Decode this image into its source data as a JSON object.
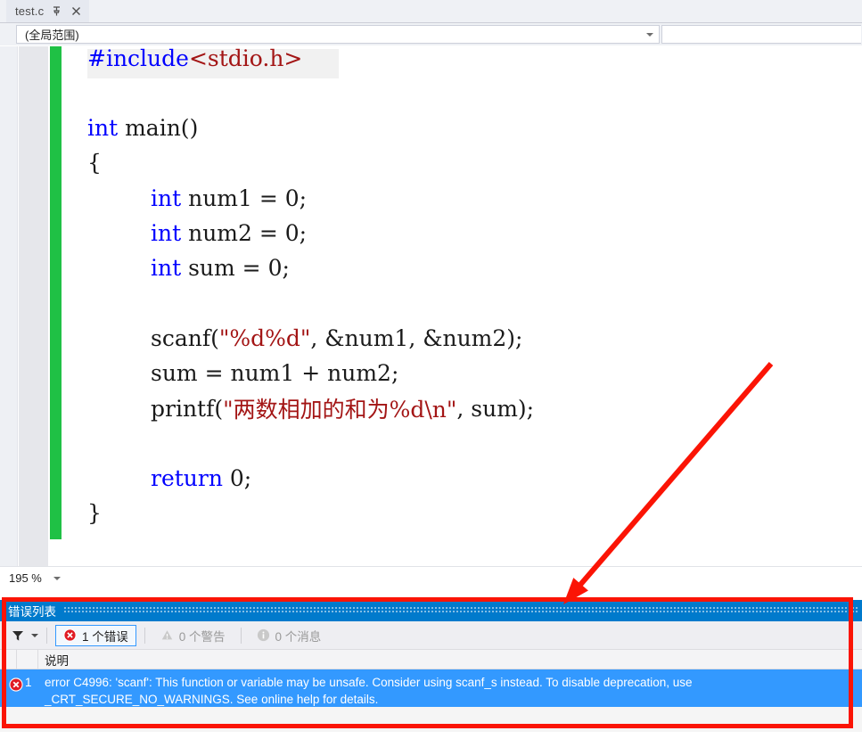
{
  "window": {
    "tab": {
      "label": "test.c",
      "pin_icon": "pin-icon",
      "close_icon": "close-icon"
    }
  },
  "navbar": {
    "scope": {
      "value": "(全局范围)",
      "caret_icon": "chevron-down-icon"
    },
    "member": {
      "value": "",
      "caret_icon": "chevron-down-icon"
    }
  },
  "editor": {
    "language": "C",
    "zoom_level": "195 %",
    "zoom_caret_icon": "chevron-down-icon",
    "collapse_icon": "collapse-minus-icon",
    "change_bar_color": "#1fc145",
    "colors": {
      "keyword": "#0000ff",
      "string": "#a31515",
      "plain": "#1a1a1a"
    },
    "lines": [
      {
        "indent": 0,
        "tokens": [
          {
            "t": "#include",
            "c": "kw"
          },
          {
            "t": "<stdio.h>",
            "c": "str"
          }
        ]
      },
      {
        "indent": 0,
        "tokens": []
      },
      {
        "indent": 0,
        "tokens": [
          {
            "t": "int",
            "c": "kw"
          },
          {
            "t": " main()",
            "c": "plain"
          }
        ]
      },
      {
        "indent": 0,
        "tokens": [
          {
            "t": "{",
            "c": "plain"
          }
        ]
      },
      {
        "indent": 1,
        "tokens": [
          {
            "t": "int",
            "c": "kw"
          },
          {
            "t": " num1 = 0;",
            "c": "plain"
          }
        ]
      },
      {
        "indent": 1,
        "tokens": [
          {
            "t": "int",
            "c": "kw"
          },
          {
            "t": " num2 = 0;",
            "c": "plain"
          }
        ]
      },
      {
        "indent": 1,
        "tokens": [
          {
            "t": "int",
            "c": "kw"
          },
          {
            "t": " sum = 0;",
            "c": "plain"
          }
        ]
      },
      {
        "indent": 0,
        "tokens": []
      },
      {
        "indent": 1,
        "tokens": [
          {
            "t": "scanf(",
            "c": "plain"
          },
          {
            "t": "\"%d%d\"",
            "c": "str"
          },
          {
            "t": ", &num1, &num2);",
            "c": "plain"
          }
        ]
      },
      {
        "indent": 1,
        "tokens": [
          {
            "t": "sum = num1 + num2;",
            "c": "plain"
          }
        ]
      },
      {
        "indent": 1,
        "tokens": [
          {
            "t": "printf(",
            "c": "plain"
          },
          {
            "t": "\"两数相加的和为%d\\n\"",
            "c": "str"
          },
          {
            "t": ", sum);",
            "c": "plain"
          }
        ]
      },
      {
        "indent": 0,
        "tokens": []
      },
      {
        "indent": 1,
        "tokens": [
          {
            "t": "return",
            "c": "kw"
          },
          {
            "t": " 0;",
            "c": "plain"
          }
        ]
      },
      {
        "indent": 0,
        "tokens": [
          {
            "t": "}",
            "c": "plain"
          }
        ]
      }
    ]
  },
  "error_list": {
    "title": "错误列表",
    "toolbar": {
      "filter_icon": "filter-icon",
      "filter_caret_icon": "chevron-down-icon",
      "errors": {
        "icon": "error-icon",
        "label": "1 个错误",
        "active": true
      },
      "warnings": {
        "icon": "warning-icon",
        "label": "0 个警告",
        "active": false
      },
      "messages": {
        "icon": "info-icon",
        "label": "0 个消息",
        "active": false
      }
    },
    "columns": [
      "说明"
    ],
    "rows": [
      {
        "icon": "error-icon",
        "number": "1",
        "description": "error C4996: 'scanf': This function or variable may be unsafe. Consider using scanf_s instead. To disable deprecation, use _CRT_SECURE_NO_WARNINGS. See online help for details.",
        "selected": true
      }
    ]
  },
  "annotations": {
    "rectangle_color": "#fb1405",
    "arrow_color": "#fb1405",
    "arrow_from": "865,408",
    "arrow_to": "632,678"
  }
}
